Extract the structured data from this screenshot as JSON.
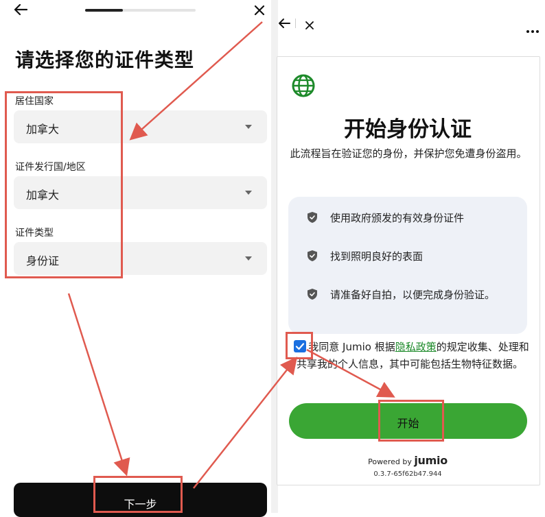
{
  "left_screen": {
    "back_icon": "arrow-left-icon",
    "close_icon": "close-icon",
    "progress": 0.34,
    "title": "请选择您的证件类型",
    "fields": [
      {
        "label": "居住国家",
        "value": "加拿大"
      },
      {
        "label": "证件发行国/地区",
        "value": "加拿大"
      },
      {
        "label": "证件类型",
        "value": "身份证"
      }
    ],
    "next_button": "下一步"
  },
  "right_screen": {
    "back_icon": "arrow-left-icon",
    "close_icon": "close-icon",
    "more_icon": "more-horizontal-icon",
    "globe_icon": "globe-icon",
    "title": "开始身份认证",
    "subtitle": "此流程旨在验证您的身份，并保护您免遭身份盗用。",
    "checklist": [
      "使用政府颁发的有效身份证件",
      "找到照明良好的表面",
      "请准备好自拍，以便完成身份验证。"
    ],
    "consent": {
      "checked": true,
      "text_before": "我同意 Jumio 根据",
      "link": "隐私政策",
      "text_after": "的规定收集、处理和共享我的个人信息，其中可能包括生物特征数据。"
    },
    "start_button": "开始",
    "powered_by": "Powered by",
    "brand": "jumio",
    "version": "0.3.7-65f62b47.944"
  },
  "colors": {
    "accent_green": "#3aa634",
    "link_green": "#1d8a2a",
    "checkbox_blue": "#1a6fe0",
    "annotation_red": "#e05a4f",
    "dark_button": "#0d0d0d"
  }
}
